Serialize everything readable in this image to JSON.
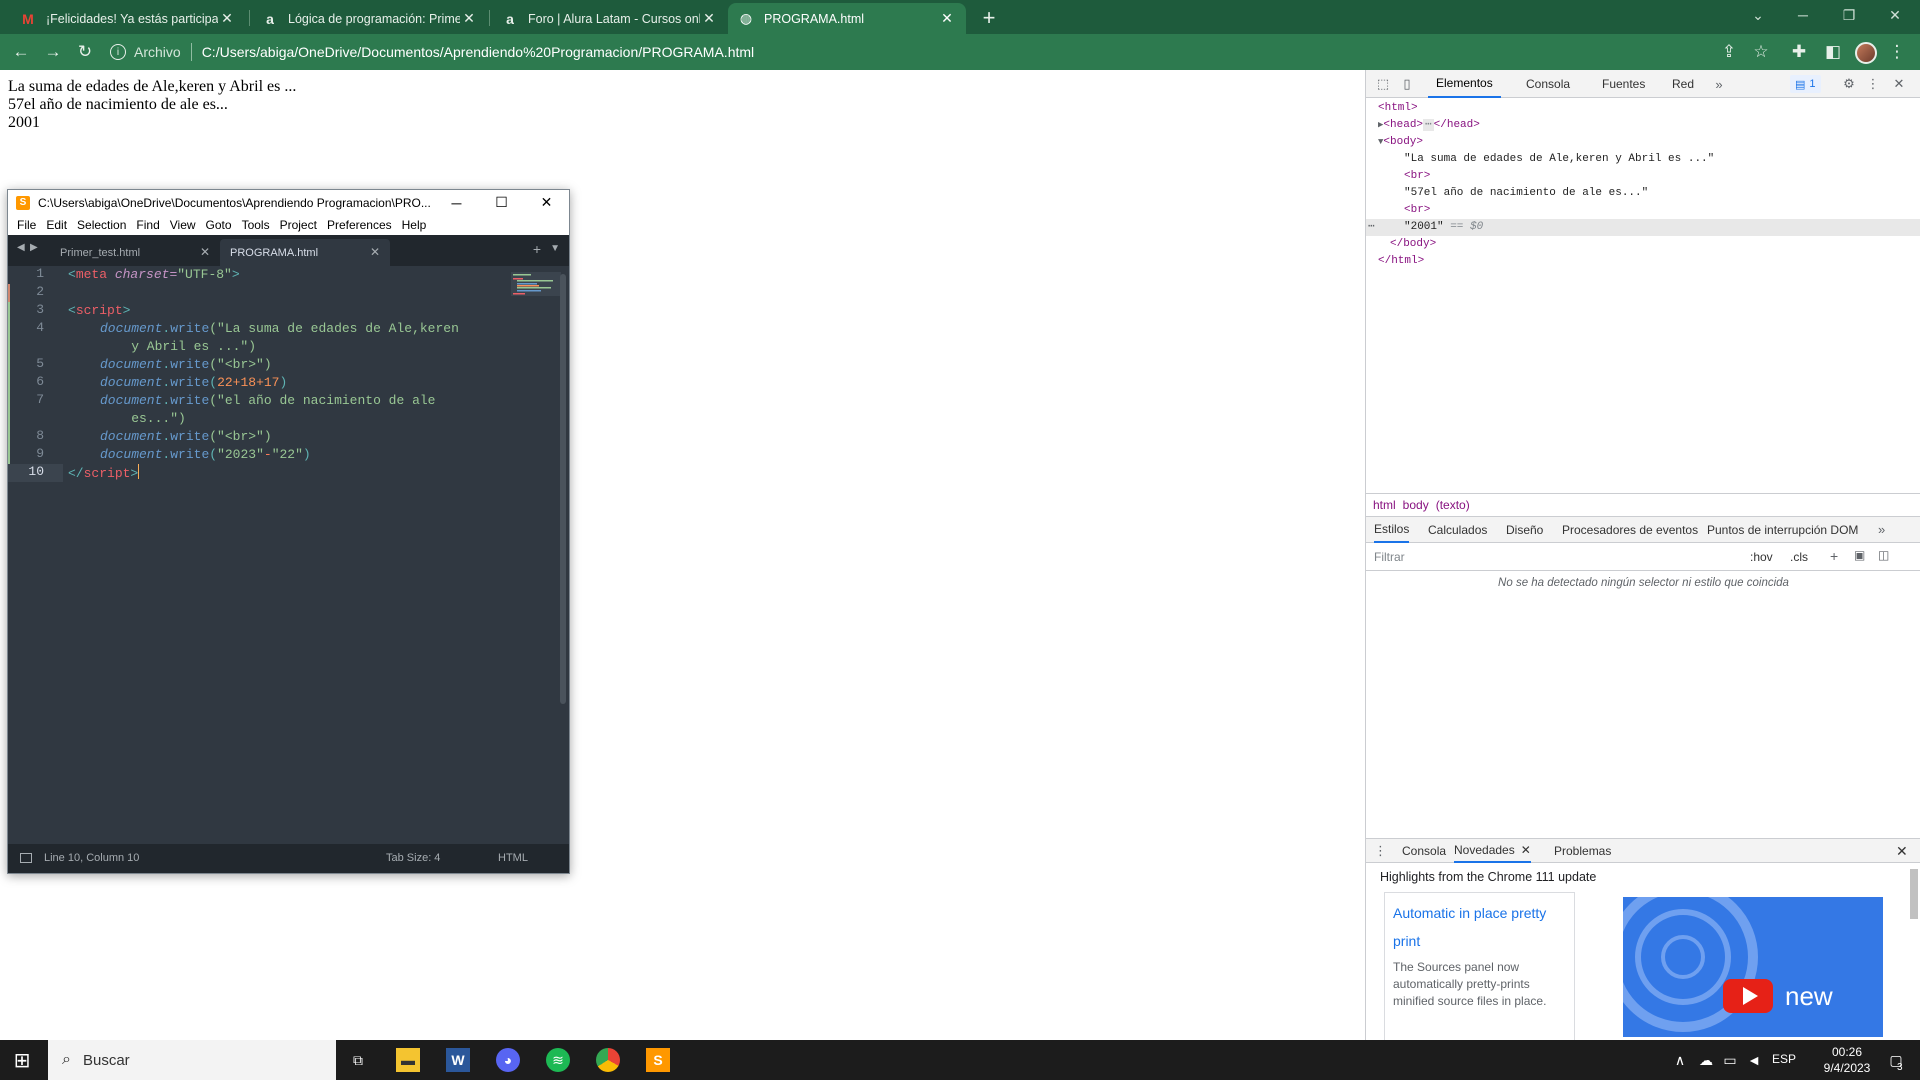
{
  "browser": {
    "tabs": [
      {
        "title": "¡Felicidades! Ya estás participando",
        "icon": "gmail-icon",
        "glyph": "M",
        "color": "#ea4335"
      },
      {
        "title": "Lógica de programación: Primeros",
        "icon": "alura-icon",
        "glyph": "a",
        "color": "#ffffff"
      },
      {
        "title": "Foro | Alura Latam - Cursos online",
        "icon": "alura-icon",
        "glyph": "a",
        "color": "#ffffff"
      },
      {
        "title": "PROGRAMA.html",
        "icon": "globe-icon",
        "glyph": "◍",
        "color": "#ffffff"
      }
    ],
    "address_scheme": "Archivo",
    "address_url": "C:/Users/abiga/OneDrive/Documentos/Aprendiendo%20Programacion/PROGRAMA.html"
  },
  "page": {
    "lines": [
      "La suma de edades de Ale,keren y Abril es ...",
      "57el año de nacimiento de ale es...",
      "2001"
    ]
  },
  "sublime": {
    "title": "C:\\Users\\abiga\\OneDrive\\Documentos\\Aprendiendo Programacion\\PRO...",
    "menu": [
      "File",
      "Edit",
      "Selection",
      "Find",
      "View",
      "Goto",
      "Tools",
      "Project",
      "Preferences",
      "Help"
    ],
    "tabs": [
      "Primer_test.html",
      "PROGRAMA.html"
    ],
    "line_numbers": [
      "1",
      "2",
      "3",
      "4",
      "",
      "5",
      "6",
      "7",
      "",
      "8",
      "9",
      "10"
    ],
    "code": {
      "l1_open": "<",
      "l1_tag": "meta",
      "l1_attr": " charset=",
      "l1_val": "\"UTF-8\"",
      "l1_close": ">",
      "l3_open": "<",
      "l3_tag": "script",
      "l3_close": ">",
      "obj": "document",
      "dot": ".",
      "method": "write",
      "l4_a": "(\"La suma de edades de Ale,keren",
      "l4_b": "    y Abril es ...\")",
      "l5": "(\"<br>\")",
      "l6_p1": "(",
      "l6_nums": "22+18+17",
      "l6_p2": ")",
      "l7_a": "(\"el año de nacimiento de ale",
      "l7_b": "    es...\")",
      "l8": "(\"<br>\")",
      "l9_a": "(",
      "l9_s1": "\"2023\"",
      "l9_op": "-",
      "l9_s2": "\"22\"",
      "l9_b": ")",
      "l10_open": "</",
      "l10_tag": "script",
      "l10_close": ">"
    },
    "status_pos": "Line 10, Column 10",
    "status_tab": "Tab Size: 4",
    "status_syntax": "HTML"
  },
  "devtools": {
    "tabs": [
      "Elementos",
      "Consola",
      "Fuentes",
      "Red"
    ],
    "issues_count": "1",
    "dom": {
      "html_open": "<html>",
      "head": "<head>",
      "head_close": "</head>",
      "body": "<body>",
      "text1": "\"La suma de edades de Ale,keren y Abril es ...\"",
      "br": "<br>",
      "text2": "\"57el año de nacimiento de ale es...\"",
      "text3": "\"2001\"",
      "eq": " == $0",
      "body_close": "</body>",
      "html_close": "</html>"
    },
    "breadcrumbs": [
      "html",
      "body",
      "(texto)"
    ],
    "style_tabs": [
      "Estilos",
      "Calculados",
      "Diseño",
      "Procesadores de eventos",
      "Puntos de interrupción DOM"
    ],
    "filter_placeholder": "Filtrar",
    "hov": ":hov",
    "cls": ".cls",
    "no_match": "No se ha detectado ningún selector ni estilo que coincida",
    "drawer_tabs": [
      "Consola",
      "Novedades",
      "Problemas"
    ],
    "highlights": "Highlights from the Chrome 111 update",
    "card_title": "Automatic in place pretty print",
    "card_body": "The Sources panel now automatically pretty-prints minified source files in place.",
    "video_text": "new"
  },
  "taskbar": {
    "search": "Buscar",
    "lang": "ESP",
    "time": "00:26",
    "date": "9/4/2023",
    "notif": "3"
  }
}
